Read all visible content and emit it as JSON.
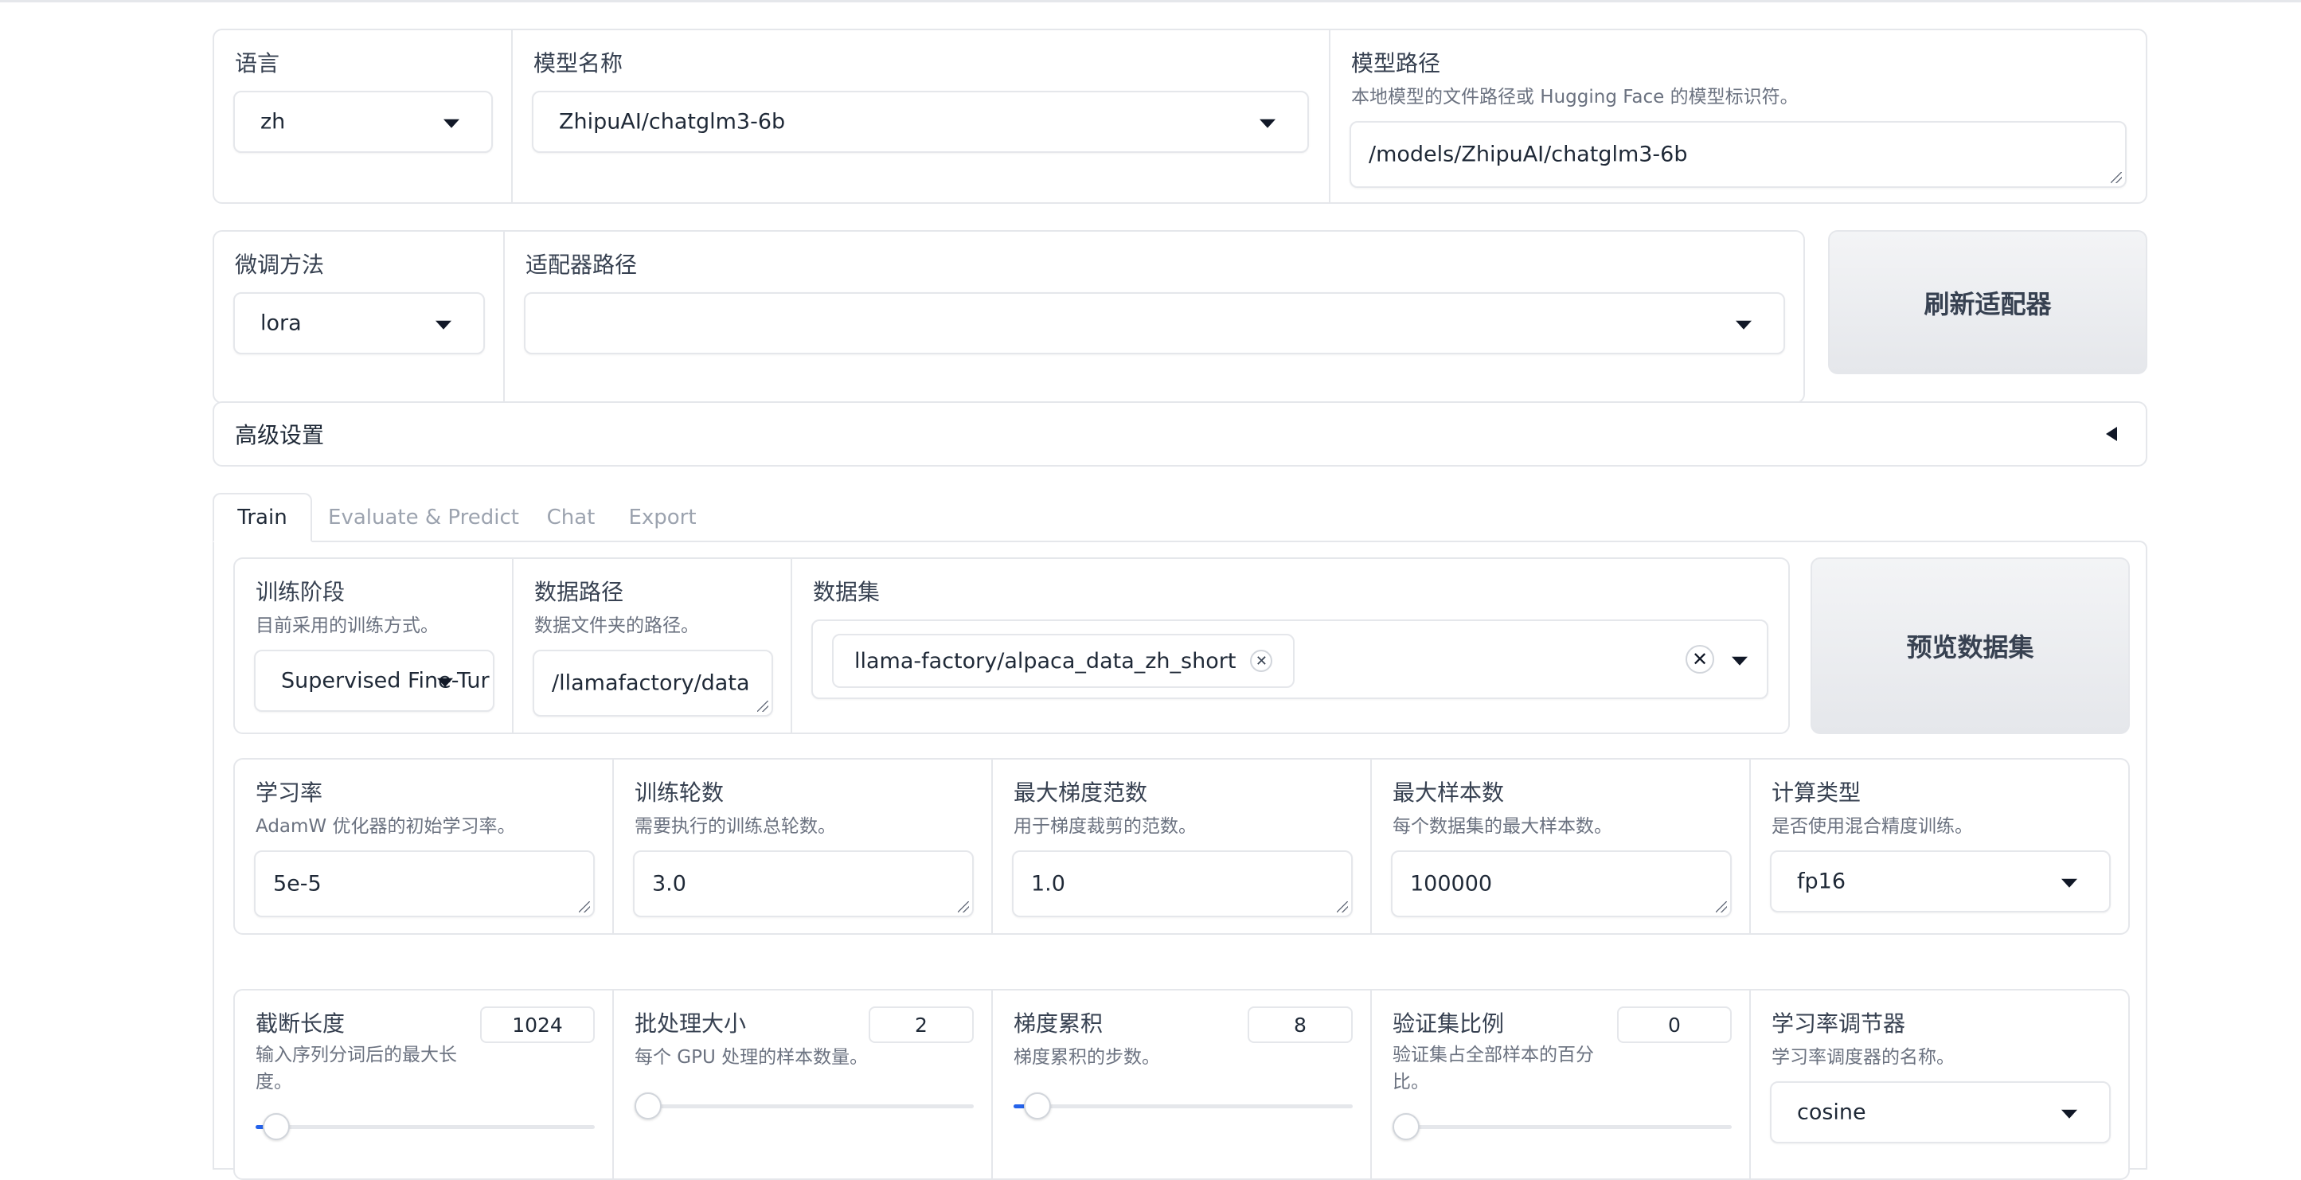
{
  "model_row": {
    "language": {
      "label": "语言",
      "value": "zh"
    },
    "model_name": {
      "label": "模型名称",
      "value": "ZhipuAI/chatglm3-6b"
    },
    "model_path": {
      "label": "模型路径",
      "info": "本地模型的文件路径或 Hugging Face 的模型标识符。",
      "value": "/models/ZhipuAI/chatglm3-6b"
    }
  },
  "adapter_row": {
    "finetune": {
      "label": "微调方法",
      "value": "lora"
    },
    "adapter_path": {
      "label": "适配器路径",
      "value": ""
    },
    "refresh_button": "刷新适配器"
  },
  "advanced": {
    "title": "高级设置"
  },
  "tabs": [
    {
      "label": "Train",
      "active": true
    },
    {
      "label": "Evaluate & Predict",
      "active": false
    },
    {
      "label": "Chat",
      "active": false
    },
    {
      "label": "Export",
      "active": false
    }
  ],
  "train": {
    "stage": {
      "label": "训练阶段",
      "info": "目前采用的训练方式。",
      "value": "Supervised Fine-Tur"
    },
    "data_dir": {
      "label": "数据路径",
      "info": "数据文件夹的路径。",
      "value": "/llamafactory/data"
    },
    "dataset": {
      "label": "数据集",
      "selected": [
        "llama-factory/alpaca_data_zh_short"
      ]
    },
    "preview_button": "预览数据集",
    "learning_rate": {
      "label": "学习率",
      "info": "AdamW 优化器的初始学习率。",
      "value": "5e-5"
    },
    "epochs": {
      "label": "训练轮数",
      "info": "需要执行的训练总轮数。",
      "value": "3.0"
    },
    "max_grad_norm": {
      "label": "最大梯度范数",
      "info": "用于梯度裁剪的范数。",
      "value": "1.0"
    },
    "max_samples": {
      "label": "最大样本数",
      "info": "每个数据集的最大样本数。",
      "value": "100000"
    },
    "compute_type": {
      "label": "计算类型",
      "info": "是否使用混合精度训练。",
      "value": "fp16"
    },
    "cutoff_len": {
      "label": "截断长度",
      "info": "输入序列分词后的最大长度。",
      "value": "1024",
      "fraction": 0.02
    },
    "batch_size": {
      "label": "批处理大小",
      "info": "每个 GPU 处理的样本数量。",
      "value": "2",
      "fraction": 0.0
    },
    "grad_accum": {
      "label": "梯度累积",
      "info": "梯度累积的步数。",
      "value": "8",
      "fraction": 0.03
    },
    "val_size": {
      "label": "验证集比例",
      "info": "验证集占全部样本的百分比。",
      "value": "0",
      "fraction": 0.0
    },
    "lr_scheduler": {
      "label": "学习率调节器",
      "info": "学习率调度器的名称。",
      "value": "cosine"
    }
  },
  "colors": {
    "accent": "#2563eb",
    "border": "#e5e7eb",
    "muted": "#6b7280"
  }
}
